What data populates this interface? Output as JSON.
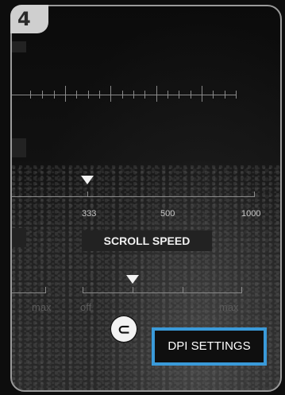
{
  "panel": {
    "badge_number": "4",
    "scroll_icon": "c-badge-icon",
    "accent_color": "#3a9ad9"
  },
  "dpi_scale": {
    "labels": [
      "333",
      "500",
      "1000"
    ]
  },
  "scroll_speed": {
    "label": "SCROLL SPEED",
    "left_max": "max",
    "off": "off",
    "max": "max"
  },
  "dpi_settings": {
    "label": "DPI SETTINGS"
  }
}
